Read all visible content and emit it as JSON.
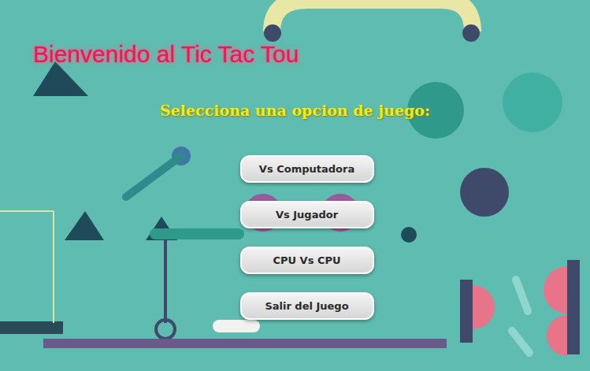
{
  "title": "Bienvenido al Tic Tac Tou",
  "subtitle": "Selecciona una opcion de juego:",
  "menu": {
    "buttons": [
      {
        "label": "Vs Computadora"
      },
      {
        "label": "Vs Jugador"
      },
      {
        "label": "CPU Vs CPU"
      },
      {
        "label": "Salir del Juego"
      }
    ]
  }
}
